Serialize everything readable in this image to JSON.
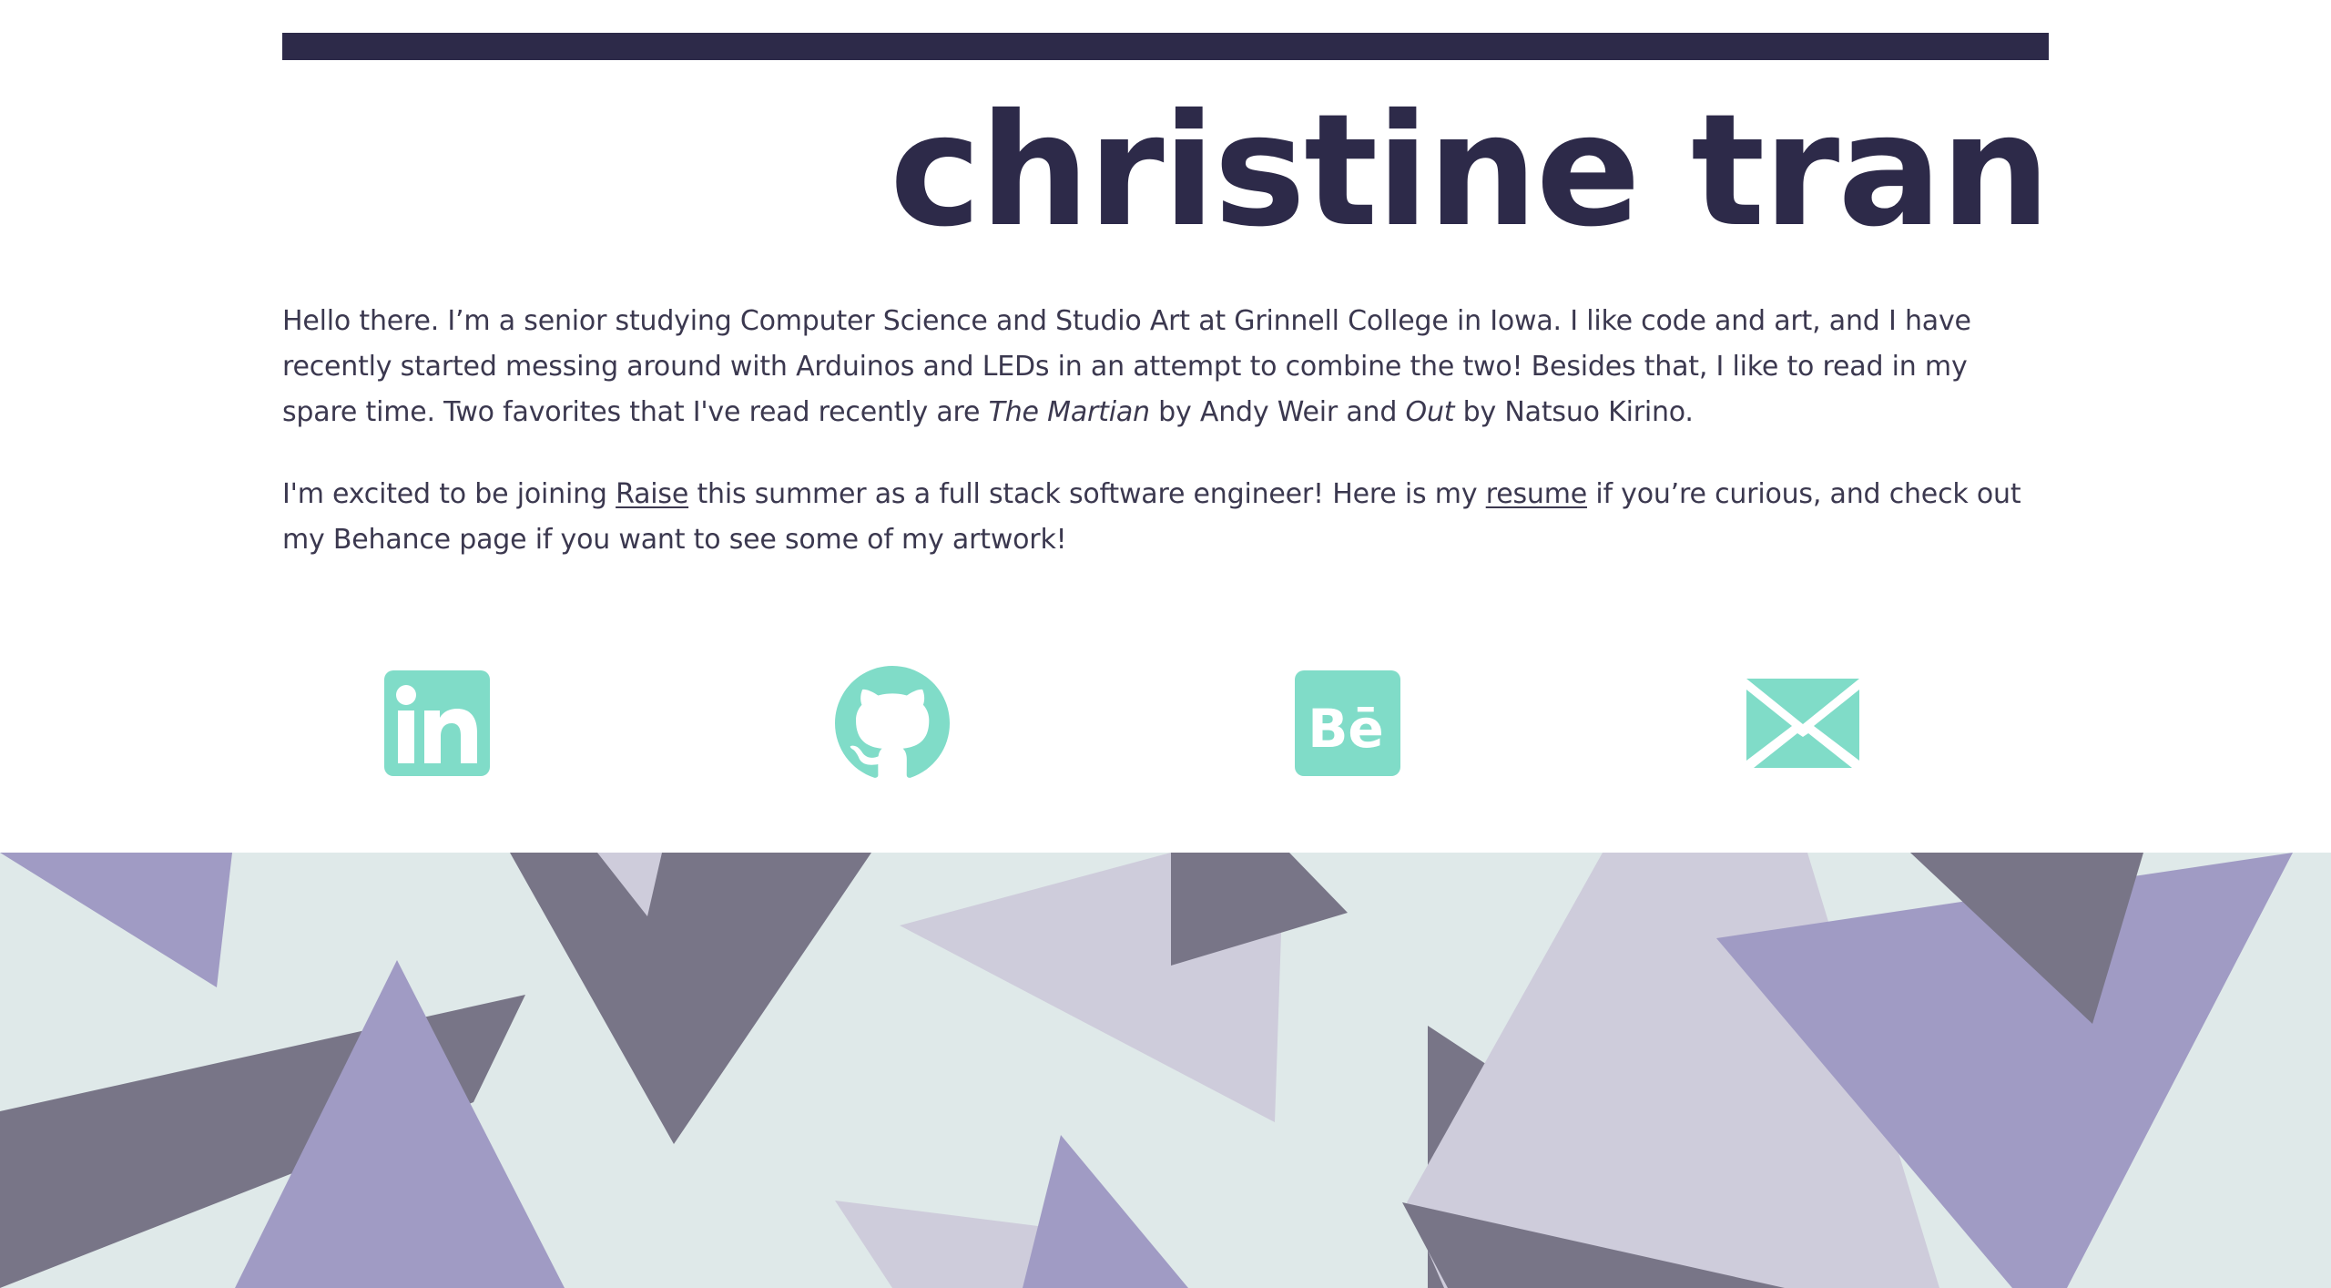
{
  "header": {
    "name": "christine tran"
  },
  "bio": {
    "p1_part1": "Hello there. I’m a senior studying Computer Science and Studio Art at Grinnell College in Iowa. I like code and art, and I have recently started messing around with Arduinos and LEDs in an attempt to combine the two! Besides that, I like to read in my spare time. Two favorites that I've read recently are ",
    "book1": "The Martian",
    "p1_part2": " by Andy Weir and ",
    "book2": "Out",
    "p1_part3": " by Natsuo Kirino.",
    "p2_part1": "I'm excited to be joining ",
    "raise_link": "Raise",
    "p2_part2": " this summer as a full stack software engineer! Here is my ",
    "resume_link": "resume",
    "p2_part3": " if you’re curious, and check out my Behance page if you want to see some of my artwork!"
  },
  "social": [
    {
      "icon": "linkedin-icon"
    },
    {
      "icon": "github-icon"
    },
    {
      "icon": "behance-icon"
    },
    {
      "icon": "mail-icon"
    }
  ],
  "colors": {
    "accent_dark": "#2d2a49",
    "text": "#3b384f",
    "icon_teal": "#80dcc8",
    "pattern_bg": "#dfe9e9",
    "triangle_lavender": "#a09bc4",
    "triangle_slate": "#787587",
    "triangle_pale": "#ceccdb"
  }
}
